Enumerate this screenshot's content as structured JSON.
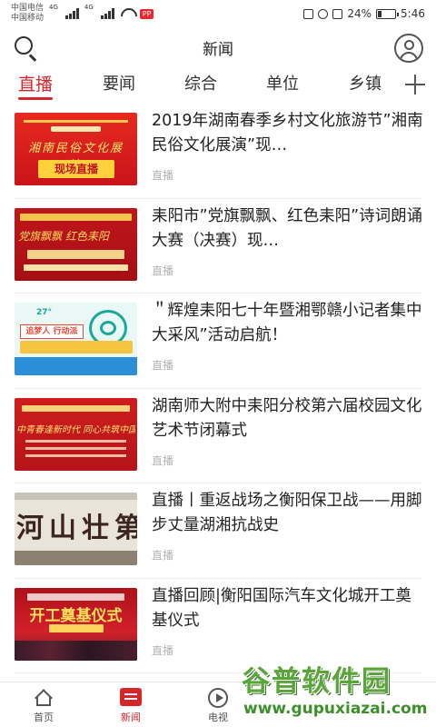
{
  "status_bar": {
    "carrier_1": "中国电信",
    "carrier_2": "中国移动",
    "net_tag_1": "4G",
    "net_tag_2": "4G",
    "app_badge": "PP",
    "battery": "24%",
    "time": "5:46"
  },
  "header": {
    "title": "新闻"
  },
  "tabs": [
    {
      "label": "直播",
      "active": true
    },
    {
      "label": "要闻",
      "active": false
    },
    {
      "label": "综合",
      "active": false
    },
    {
      "label": "单位",
      "active": false
    },
    {
      "label": "乡镇",
      "active": false
    }
  ],
  "feed": [
    {
      "title": "2019年湖南春季乡村文化旅游节”湘南民俗文化展演”现…",
      "tag": "直播",
      "thumb_text": "湘南民俗文化展演",
      "thumb_badge": "现场直播"
    },
    {
      "title": "耒阳市”党旗飘飘、红色耒阳”诗词朗诵大赛（决赛）现…",
      "tag": "直播",
      "thumb_text": "党旗飘飘 红色耒阳"
    },
    {
      "title": "＂辉煌耒阳七十年暨湘鄂赣小记者集中大采风”活动启航！",
      "tag": "直播",
      "thumb_badge": "追梦人 行动派",
      "thumb_num": "27°"
    },
    {
      "title": "湖南师大附中耒阳分校第六届校园文化艺术节闭幕式",
      "tag": "直播",
      "thumb_text": "中青春逢新时代 同心共筑中国梦"
    },
    {
      "title": "直播丨重返战场之衡阳保卫战——用脚步丈量湖湘抗战史",
      "tag": "直播",
      "thumb_text": "河山壮第"
    },
    {
      "title": "直播回顾|衡阳国际汽车文化城开工奠基仪式",
      "tag": "直播",
      "thumb_text": "开工奠基仪式"
    }
  ],
  "bottom_nav": [
    {
      "label": "首页",
      "icon": "home-icon",
      "active": false
    },
    {
      "label": "新闻",
      "icon": "news-icon",
      "active": true
    },
    {
      "label": "电视",
      "icon": "tv-icon",
      "active": false
    }
  ],
  "watermark": {
    "title": "谷普软件园",
    "url": "www.gupuxiazai.com"
  },
  "colors": {
    "accent": "#d7262b",
    "watermark_green": "#59a53a"
  }
}
